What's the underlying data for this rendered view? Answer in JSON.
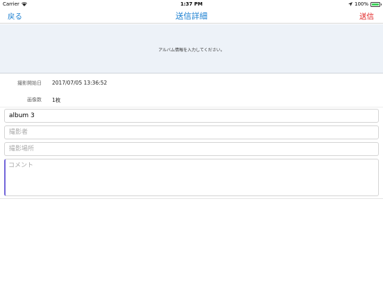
{
  "status_bar": {
    "carrier": "Carrier",
    "time": "1:37 PM",
    "battery": "100%",
    "battery_level": 1.0
  },
  "nav": {
    "back_label": "戻る",
    "title": "送信詳細",
    "send_label": "送信"
  },
  "banner": {
    "message": "アルバム情報を入力してください。"
  },
  "info": {
    "date_label": "撮影開始日",
    "date_value": "2017/07/05 13:36:52",
    "count_label": "画像数",
    "count_value": "1枚"
  },
  "form": {
    "album_value": "album 3",
    "photographer_placeholder": "撮影者",
    "place_placeholder": "撮影場所",
    "comment_placeholder": "コメント"
  },
  "colors": {
    "link": "#1a7fd1",
    "send": "#e02020",
    "banner_bg": "#edf2f8"
  }
}
